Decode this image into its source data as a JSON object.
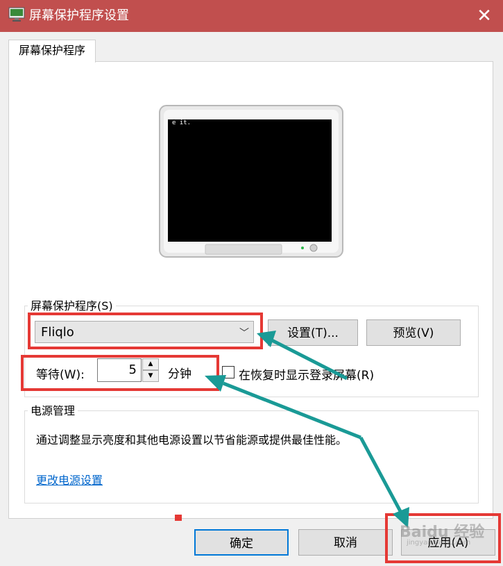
{
  "window": {
    "title": "屏幕保护程序设置",
    "close_glyph": "✕"
  },
  "tab": {
    "label": "屏幕保护程序"
  },
  "preview": {
    "screen_text": "e it."
  },
  "screensaver": {
    "group_label": "屏幕保护程序(S)",
    "selected": "Fliqlo",
    "dropdown_arrow": "﹀",
    "settings_label": "设置(T)...",
    "preview_label": "预览(V)",
    "wait_label": "等待(W):",
    "wait_value": "5",
    "spin_up": "▲",
    "spin_down": "▼",
    "unit": "分钟",
    "resume_label": "在恢复时显示登录屏幕(R)",
    "resume_checked": false
  },
  "power": {
    "group_label": "电源管理",
    "description": "通过调整显示亮度和其他电源设置以节省能源或提供最佳性能。",
    "link": "更改电源设置"
  },
  "footer": {
    "ok": "确定",
    "cancel": "取消",
    "apply": "应用(A)"
  },
  "watermark": {
    "brand": "Baidu 经验",
    "url": "jingyan.baidu.com"
  },
  "colors": {
    "titlebar": "#c14f4e",
    "highlight": "#e53935",
    "arrow": "#1a9a96",
    "link": "#0066cc"
  }
}
